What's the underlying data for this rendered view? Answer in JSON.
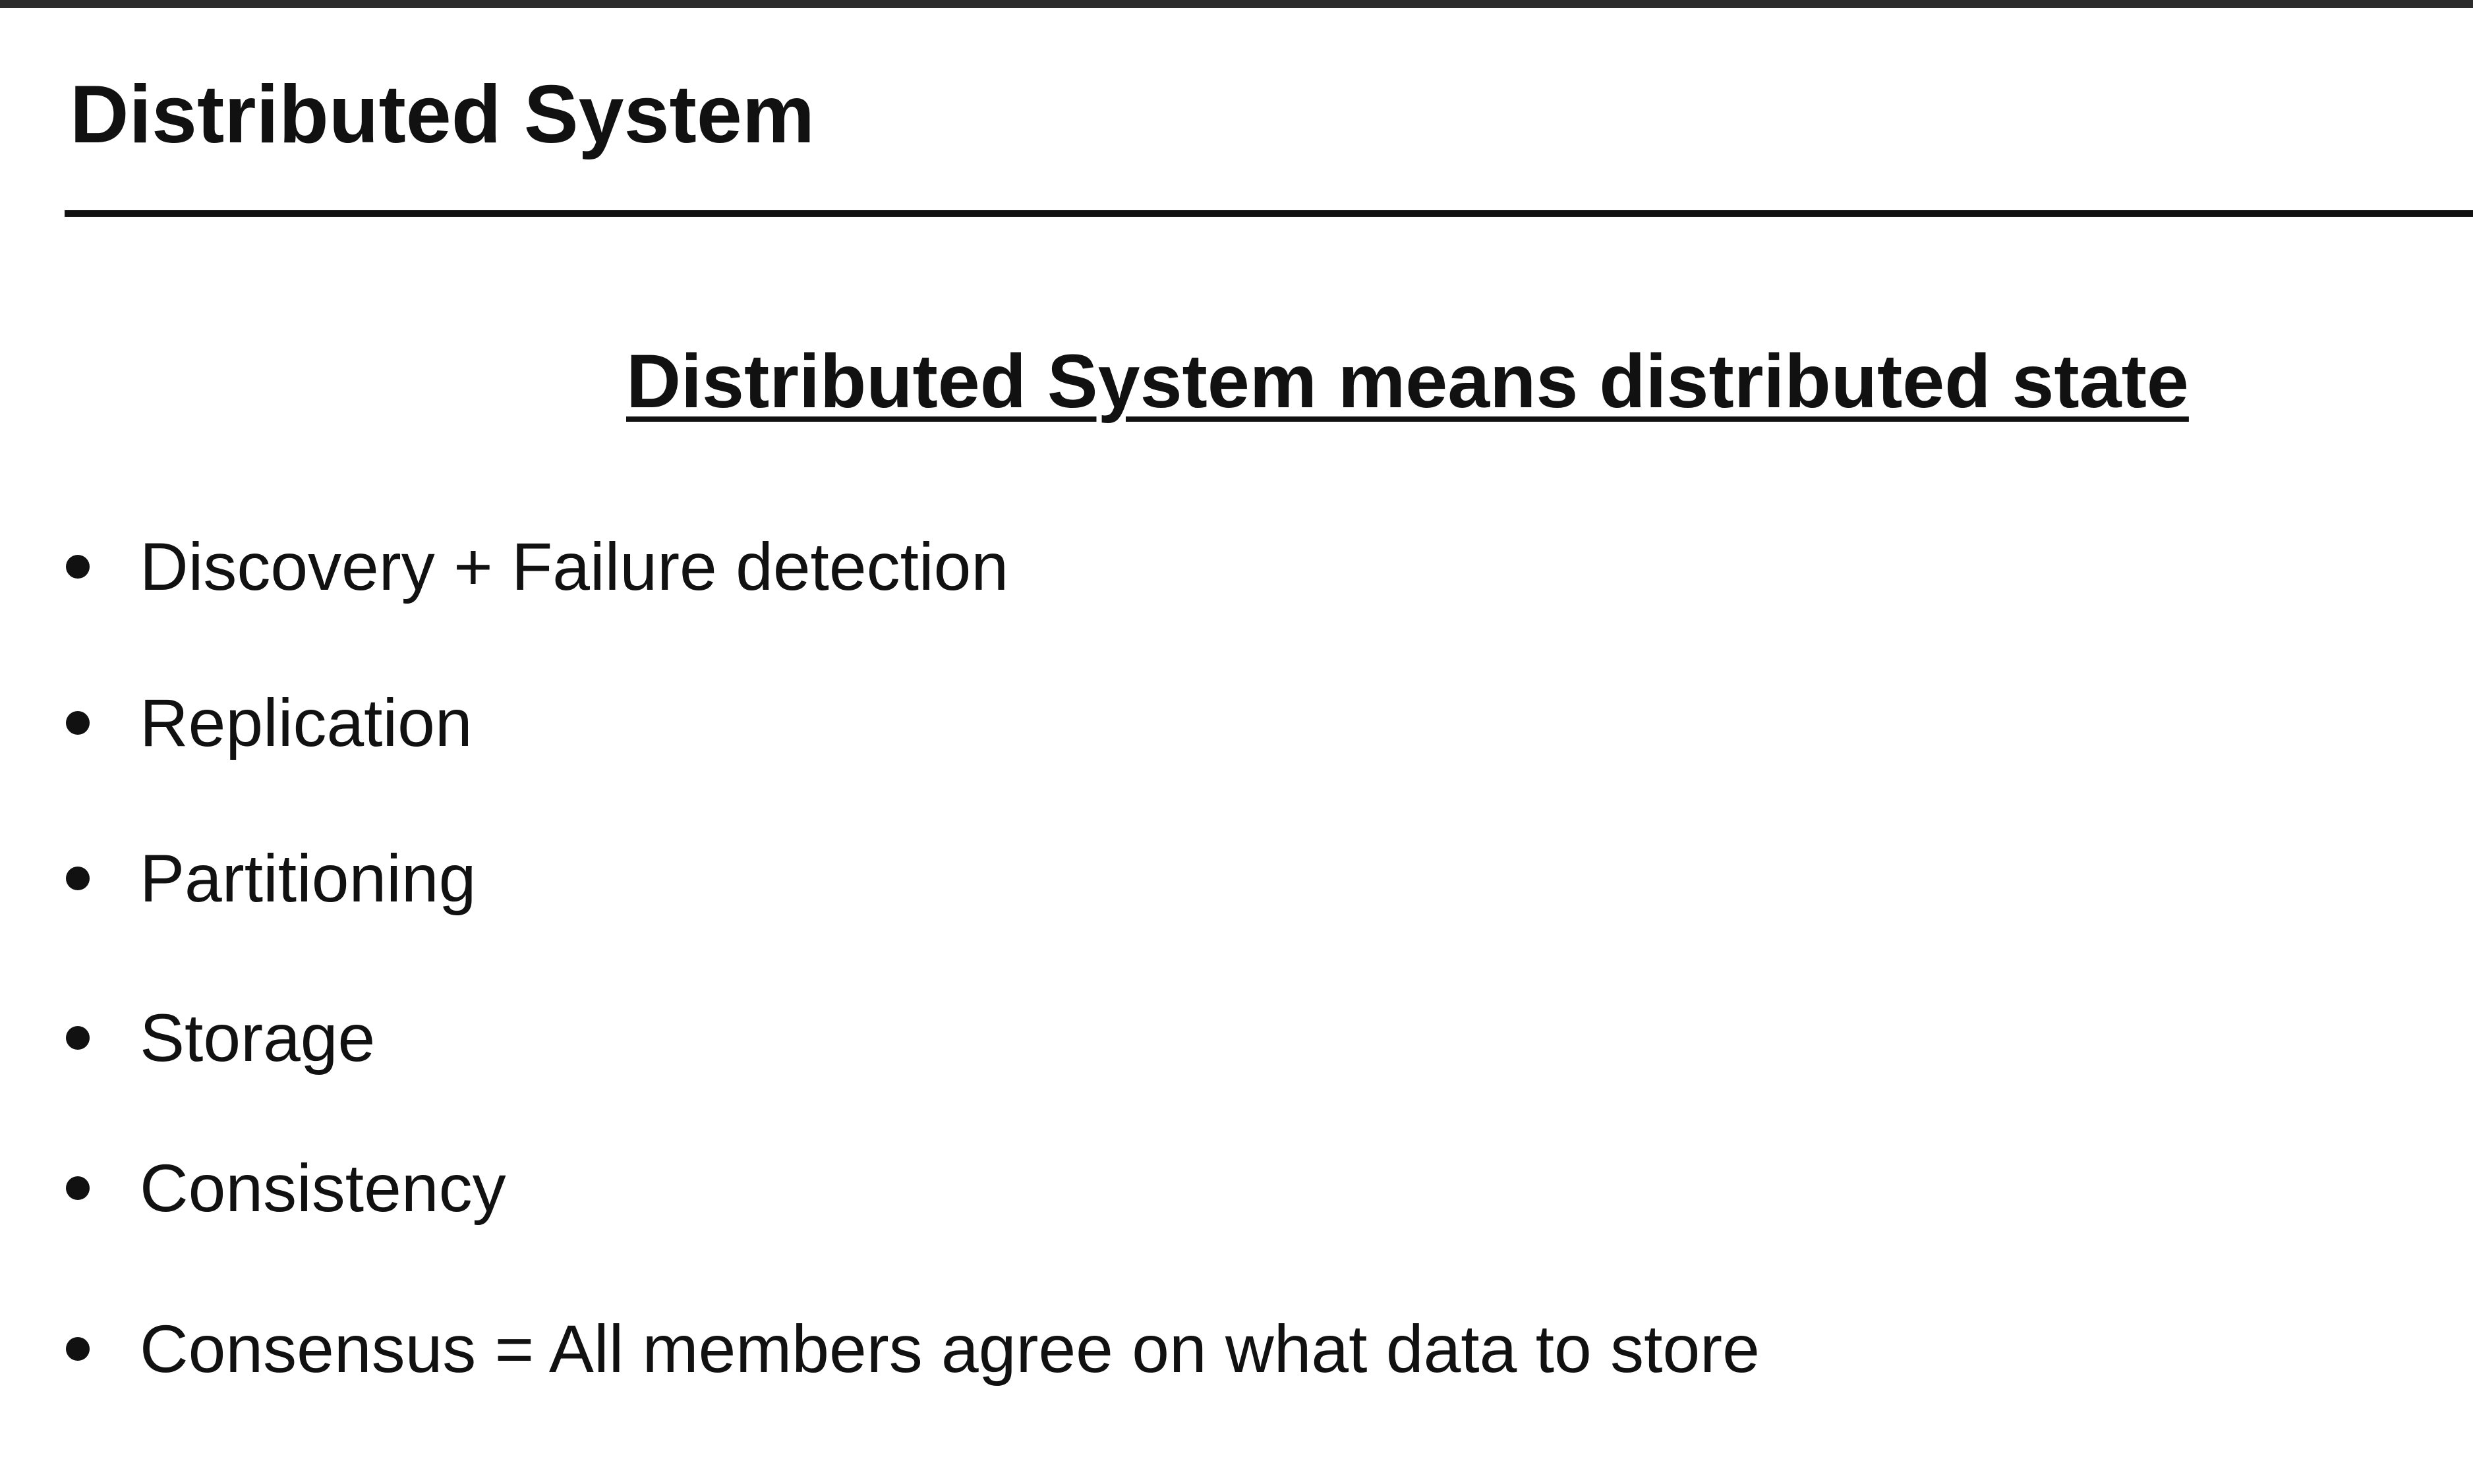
{
  "slide": {
    "title": "Distributed System",
    "subtitle": "Distributed System means distributed state",
    "bullets": [
      "Discovery + Failure detection",
      "Replication",
      "Partitioning",
      "Storage",
      "Consistency",
      "Consensus = All members agree on what data to store"
    ]
  }
}
